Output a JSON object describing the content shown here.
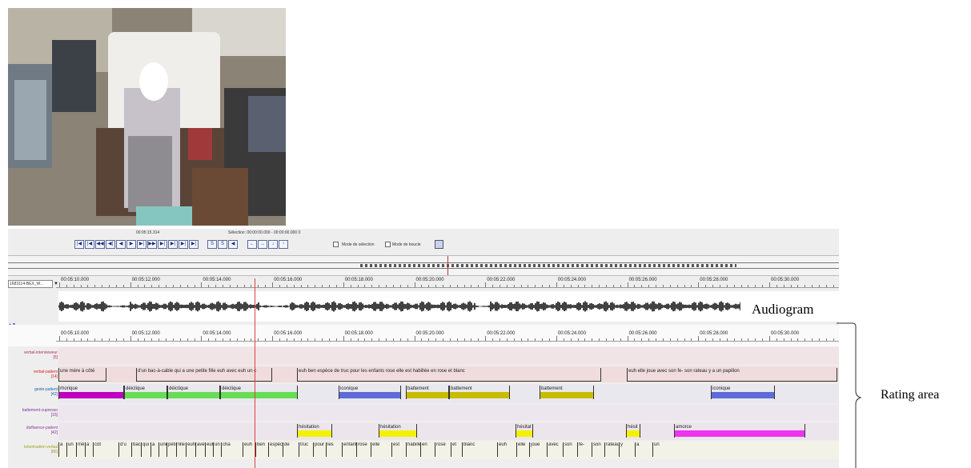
{
  "controls": {
    "time_display": "00:05:15.314",
    "selection_text": "Sélection: 00:00:00.000 - 00:00:00.000  0",
    "buttons": [
      "|◀",
      "|◀",
      "◀◀",
      "◀|",
      "◀",
      "▶",
      "▶|",
      "▶▶",
      "▶|",
      "▶|",
      "▶|",
      "▶|"
    ],
    "buttons2": [
      "S",
      "S",
      "◀"
    ],
    "buttons3": [
      "←",
      "→",
      "↓",
      "↑"
    ],
    "selection_mode": "Mode de sélection",
    "loop_mode": "Mode de boucle",
    "media_name": "1683114-BEX_W..."
  },
  "ruler_labels": [
    "00:05:10.000",
    "00:05:12.000",
    "00:05:14.000",
    "00:05:16.000",
    "00:05:18.000",
    "00:05:20.000",
    "00:05:22.000",
    "00:05:24.000",
    "00:05:26.000",
    "00:05:28.000",
    "00:05:30.000",
    "00"
  ],
  "tiers": [
    {
      "name": "verbal-intervieweur",
      "count": "[5]",
      "color": "#b03060"
    },
    {
      "name": "verbal-patient",
      "count": "[14]",
      "color": "#d02020"
    },
    {
      "name": "geste-patient",
      "count": "[42]",
      "color": "#2060b0"
    },
    {
      "name": "battement-cupresso",
      "count": "[15]",
      "color": "#8030a0"
    },
    {
      "name": "disfluence-patient",
      "count": "[42]",
      "color": "#9030a0"
    },
    {
      "name": "tokenisation-verbal",
      "count": "[86]",
      "color": "#a0a020"
    }
  ],
  "verbal_segments": [
    "une mère à côté",
    "d'un bac-à-cable qui a une petite fille euh avec euh un c",
    "euh ben espèce de truc pour les enfants rose elle est habillée en rose et blanc",
    "euh elle joue avec son fe- son rateau y a un papillon"
  ],
  "gesture_segments": [
    {
      "label": "rhorique",
      "color": "#c000c0"
    },
    {
      "label": "déictique",
      "color": "#66dd55"
    },
    {
      "label": "déictique",
      "color": "#66dd55"
    },
    {
      "label": "déictique",
      "color": "#66dd55"
    },
    {
      "label": "iconique",
      "color": "#5f6bd8"
    },
    {
      "label": "battement",
      "color": "#c8bc00"
    },
    {
      "label": "battement",
      "color": "#c8bc00"
    },
    {
      "label": "battement",
      "color": "#c8bc00"
    },
    {
      "label": "iconique",
      "color": "#5f6bd8"
    }
  ],
  "disfluence_segments": [
    {
      "label": "hésitation",
      "color": "#f2f200"
    },
    {
      "label": "hésitation",
      "color": "#f2f200"
    },
    {
      "label": "hésitat",
      "color": "#f2f200"
    },
    {
      "label": "hésit",
      "color": "#f2f200"
    },
    {
      "label": "amorce",
      "color": "#ee33ee"
    }
  ],
  "tokens": [
    "a",
    "un",
    "mè",
    "à",
    "côt",
    "d'u",
    "bac",
    "qui",
    "a",
    "une",
    "peti",
    "fille",
    "euh",
    "ave",
    "euh",
    "un",
    "cha",
    "euh",
    "ben",
    "espèc",
    "de",
    "truc",
    "pour",
    "les",
    "enfant",
    "rose",
    "elle",
    "est",
    "habillé",
    "en",
    "rose",
    "et",
    "blanc",
    "euh",
    "elle",
    "joue",
    "avec",
    "son",
    "fe-",
    "son",
    "rateau",
    "y",
    "a",
    "un"
  ],
  "annotations": {
    "audiogram": "Audiogram",
    "rating_area": "Rating area"
  }
}
